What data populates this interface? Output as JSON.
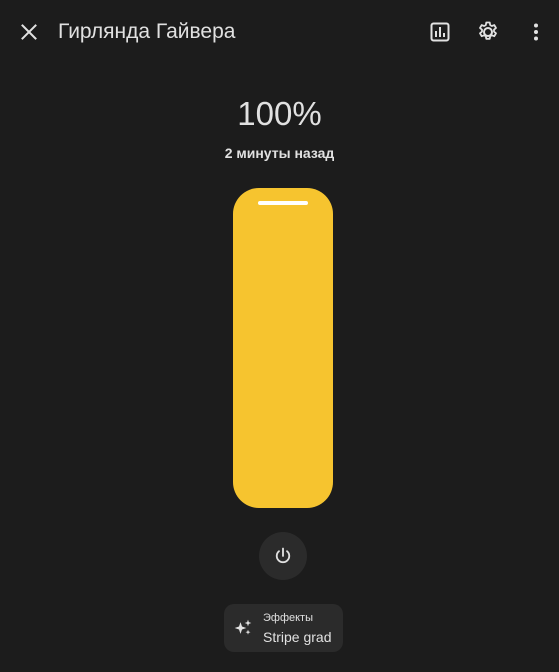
{
  "header": {
    "title": "Гирлянда Гайвера",
    "close_icon": "close-icon",
    "history_icon": "chart-box-icon",
    "settings_icon": "gear-icon",
    "more_icon": "dots-vertical-icon"
  },
  "state": {
    "brightness_text": "100%",
    "brightness_fraction": 1.0,
    "last_changed": "2 минуты назад"
  },
  "controls": {
    "power_icon": "power-icon",
    "effects": {
      "icon": "sparkles-icon",
      "label": "Эффекты",
      "value": "Stripe grad"
    }
  },
  "colors": {
    "accent": "#f6c42f",
    "background": "#1c1c1c",
    "button_bg": "#2b2b2b",
    "text": "#e1e1e1"
  }
}
